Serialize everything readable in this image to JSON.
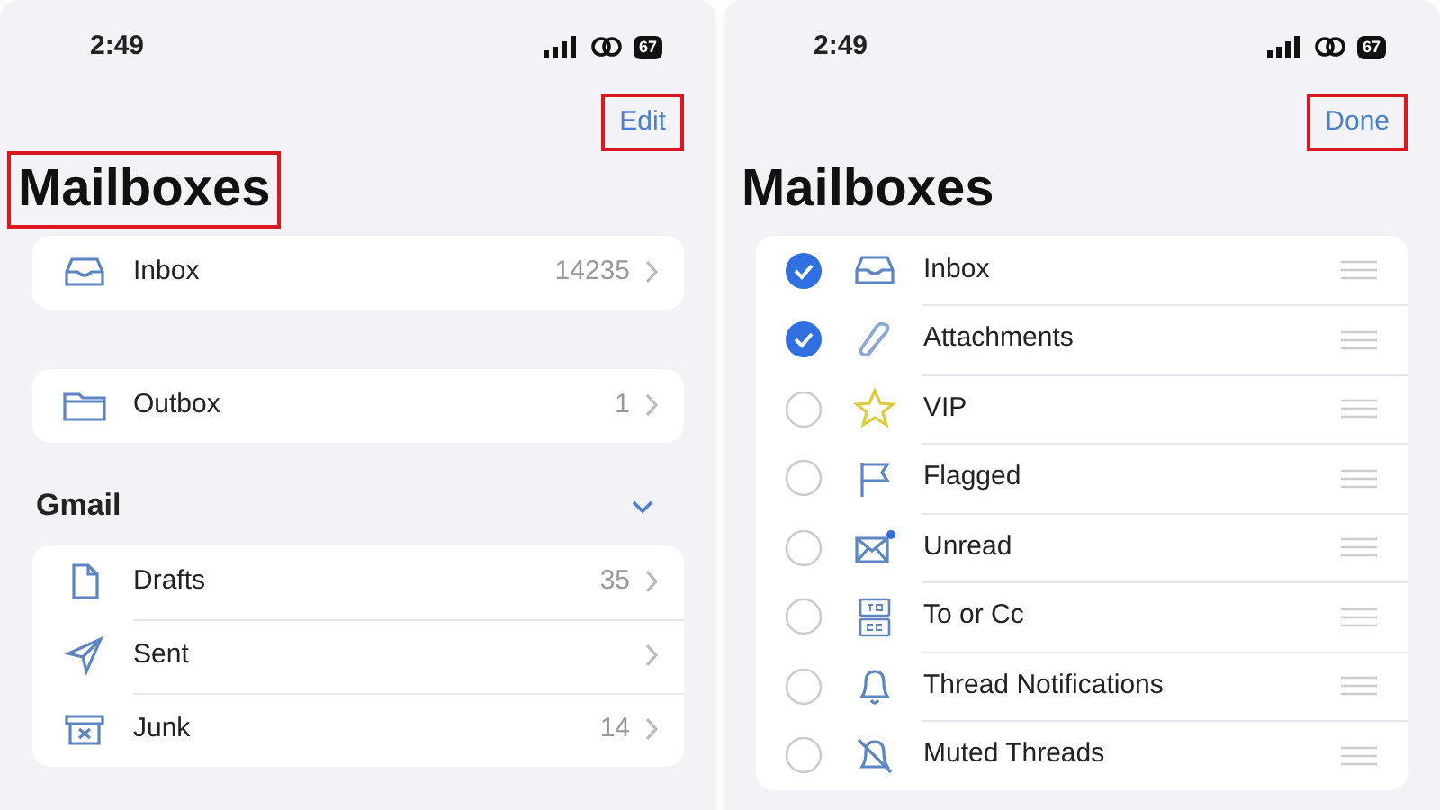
{
  "screens": [
    {
      "status_bar": {
        "time": "2:49",
        "battery": "67"
      },
      "nav_button": {
        "label": "Edit",
        "highlighted": true
      },
      "title": {
        "text": "Mailboxes",
        "highlighted": true
      },
      "sections": [
        {
          "rows": [
            {
              "kind": "inbox",
              "label": "Inbox",
              "count": "14235"
            }
          ]
        },
        {
          "rows": [
            {
              "kind": "folder",
              "label": "Outbox",
              "count": "1"
            }
          ]
        },
        {
          "header": "Gmail",
          "expanded": true,
          "rows": [
            {
              "kind": "document",
              "label": "Drafts",
              "count": "35"
            },
            {
              "kind": "plane",
              "label": "Sent"
            },
            {
              "kind": "junk",
              "label": "Junk",
              "count": "14"
            }
          ]
        }
      ]
    },
    {
      "status_bar": {
        "time": "2:49",
        "battery": "67"
      },
      "nav_button": {
        "label": "Done",
        "highlighted": true
      },
      "title": {
        "text": "Mailboxes",
        "highlighted": false
      },
      "edit_list": [
        {
          "kind": "inbox",
          "label": "Inbox",
          "checked": true
        },
        {
          "kind": "paperclip",
          "label": "Attachments",
          "checked": true
        },
        {
          "kind": "star",
          "label": "VIP",
          "checked": false
        },
        {
          "kind": "flag",
          "label": "Flagged",
          "checked": false
        },
        {
          "kind": "envelope",
          "label": "Unread",
          "checked": false
        },
        {
          "kind": "tocc",
          "label": "To or Cc",
          "checked": false
        },
        {
          "kind": "bell",
          "label": "Thread Notifications",
          "checked": false
        },
        {
          "kind": "bellslash",
          "label": "Muted Threads",
          "checked": false
        }
      ]
    }
  ]
}
